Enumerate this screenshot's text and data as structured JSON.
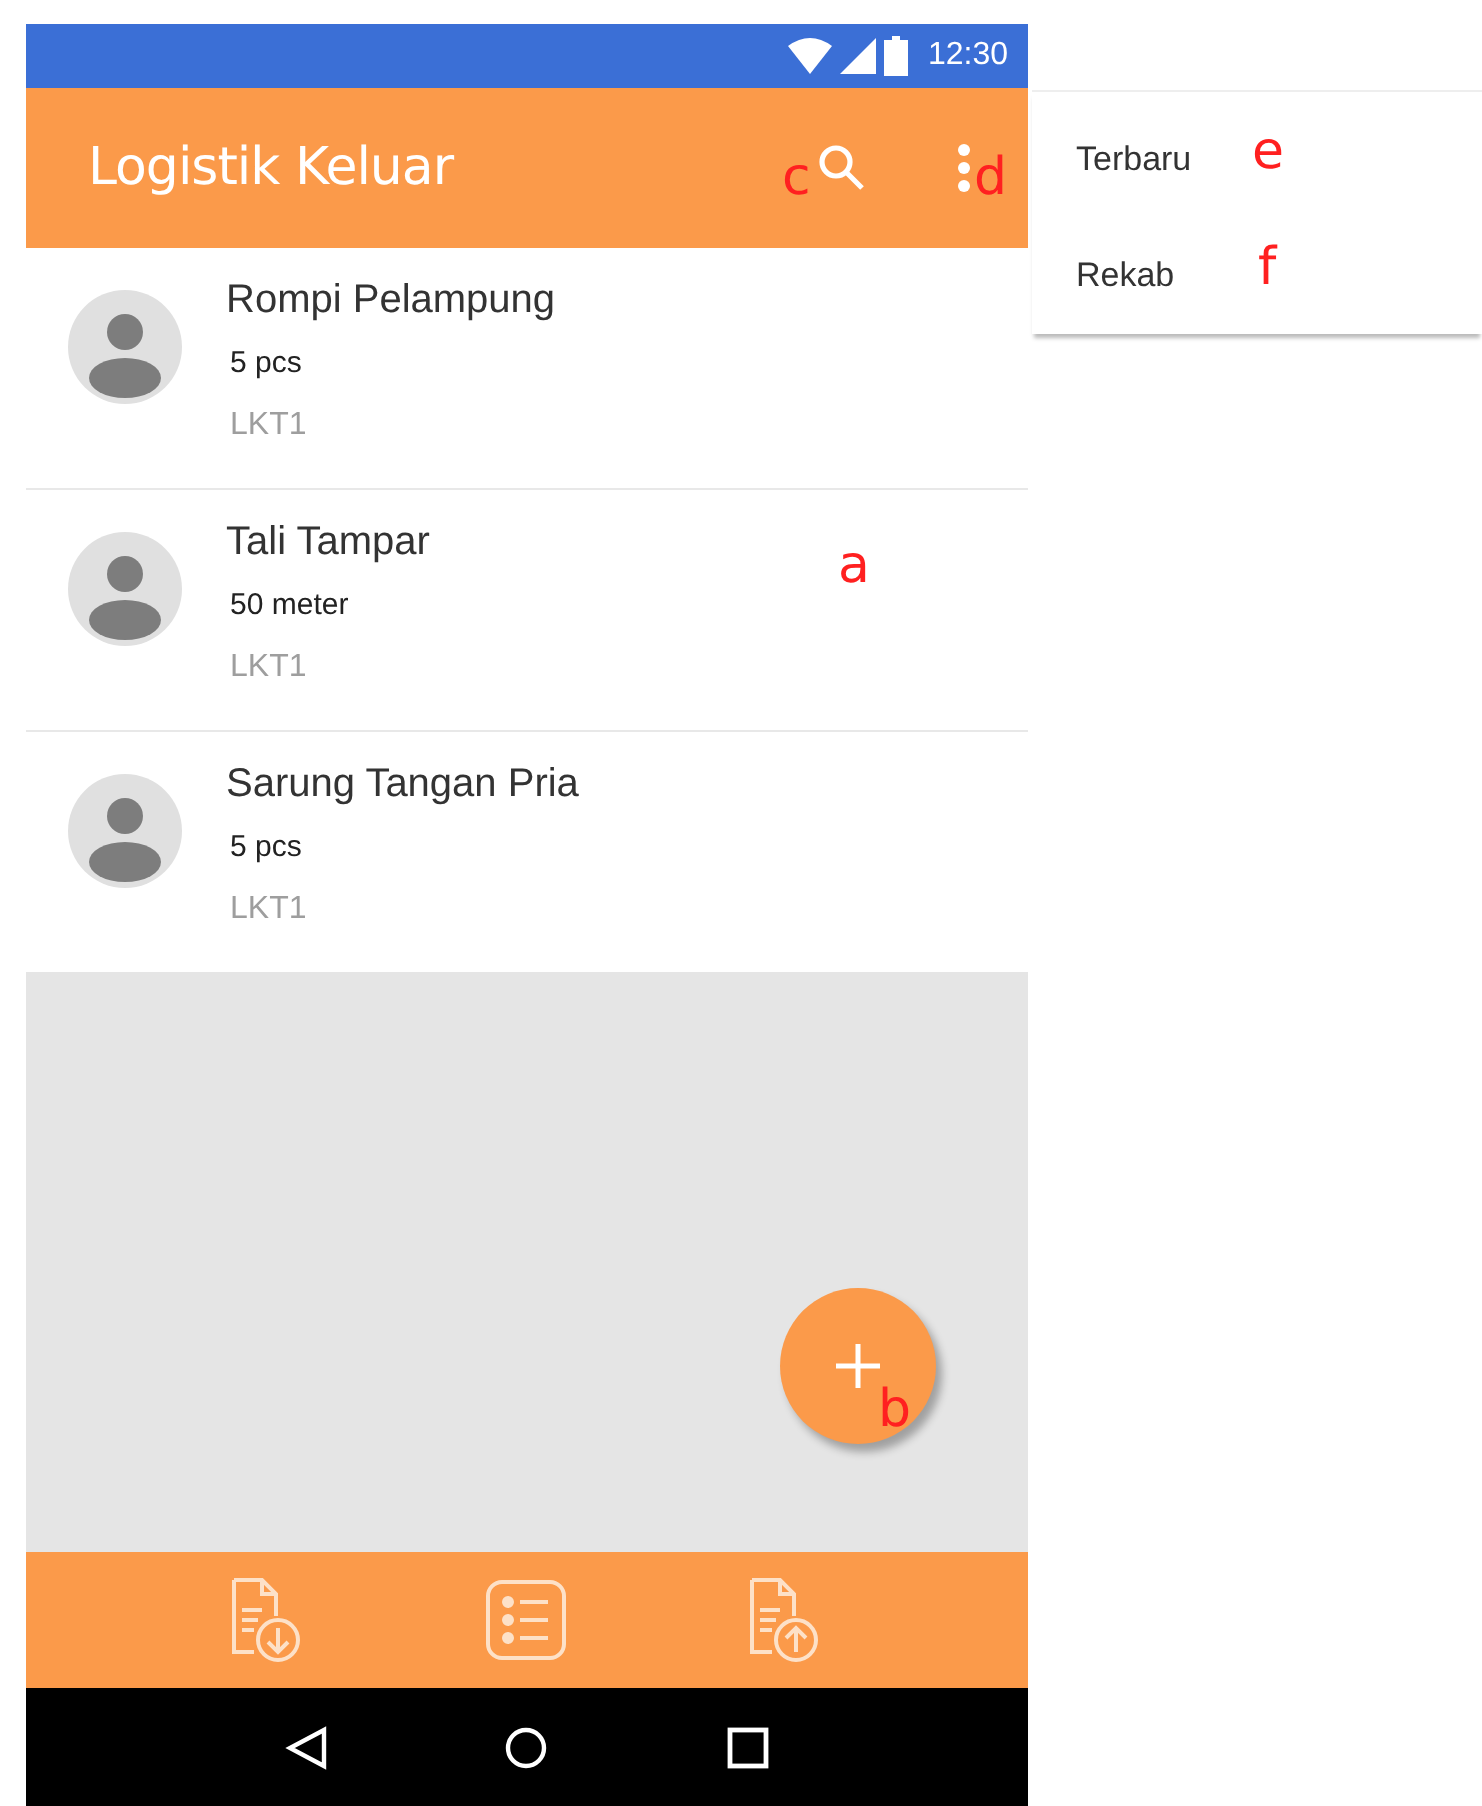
{
  "status_bar": {
    "time": "12:30"
  },
  "app_bar": {
    "title": "Logistik Keluar"
  },
  "items": [
    {
      "name": "Rompi Pelampung",
      "quantity": "5 pcs",
      "code": "LKT1"
    },
    {
      "name": "Tali Tampar",
      "quantity": "50 meter",
      "code": "LKT1"
    },
    {
      "name": "Sarung Tangan Pria",
      "quantity": "5 pcs",
      "code": "LKT1"
    }
  ],
  "overflow_menu": {
    "items": [
      {
        "label": "Terbaru"
      },
      {
        "label": "Rekab"
      }
    ]
  },
  "annotations": [
    {
      "label": "c"
    },
    {
      "label": "d"
    },
    {
      "label": "a"
    },
    {
      "label": "b"
    },
    {
      "label": "e"
    },
    {
      "label": "f"
    }
  ]
}
